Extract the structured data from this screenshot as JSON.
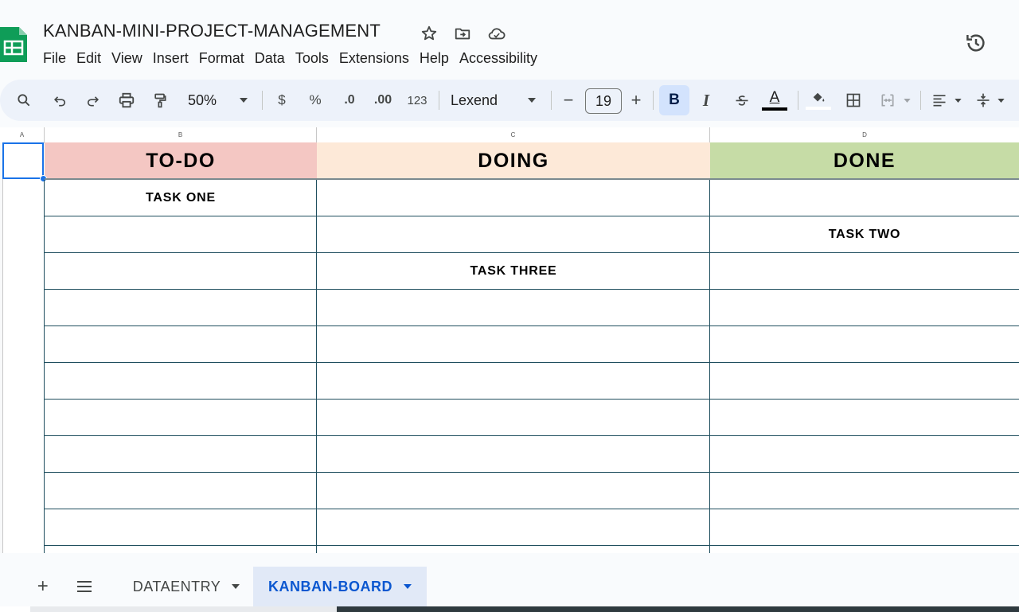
{
  "app": {
    "title": "KANBAN-MINI-PROJECT-MANAGEMENT",
    "logo_icon": "sheets-logo-icon",
    "title_icons": [
      "star-icon",
      "move-to-folder-icon",
      "cloud-status-icon"
    ],
    "history_icon": "version-history-icon",
    "accent_color": "#0f9d58"
  },
  "menu": {
    "items": [
      "File",
      "Edit",
      "View",
      "Insert",
      "Format",
      "Data",
      "Tools",
      "Extensions",
      "Help",
      "Accessibility"
    ]
  },
  "toolbar": {
    "zoom": "50%",
    "currency_label": "$",
    "percent_label": "%",
    "decrease_decimal_label": ".0",
    "increase_decimal_label": ".00",
    "number_format_label": "123",
    "font_name": "Lexend",
    "font_size": "19",
    "minus_label": "−",
    "plus_label": "+",
    "bold_label": "B",
    "italic_label": "I",
    "text_color_label": "A"
  },
  "grid": {
    "col_headers": [
      "A",
      "B",
      "C",
      "D"
    ],
    "header_row": [
      {
        "text": "TO-DO",
        "color": "#f4c7c3"
      },
      {
        "text": "DOING",
        "color": "#fde9d8"
      },
      {
        "text": "DONE",
        "color": "#c6dca6"
      }
    ],
    "rows": [
      [
        "TASK ONE",
        "",
        ""
      ],
      [
        "",
        "",
        "TASK TWO"
      ],
      [
        "",
        "TASK THREE",
        ""
      ],
      [
        "",
        "",
        ""
      ],
      [
        "",
        "",
        ""
      ],
      [
        "",
        "",
        ""
      ],
      [
        "",
        "",
        ""
      ],
      [
        "",
        "",
        ""
      ],
      [
        "",
        "",
        ""
      ],
      [
        "",
        "",
        ""
      ]
    ]
  },
  "sheets": {
    "add_label": "+",
    "tabs": [
      {
        "label": "DATAENTRY",
        "active": false
      },
      {
        "label": "KANBAN-BOARD",
        "active": true
      }
    ],
    "active_color": "#0b57d0"
  }
}
